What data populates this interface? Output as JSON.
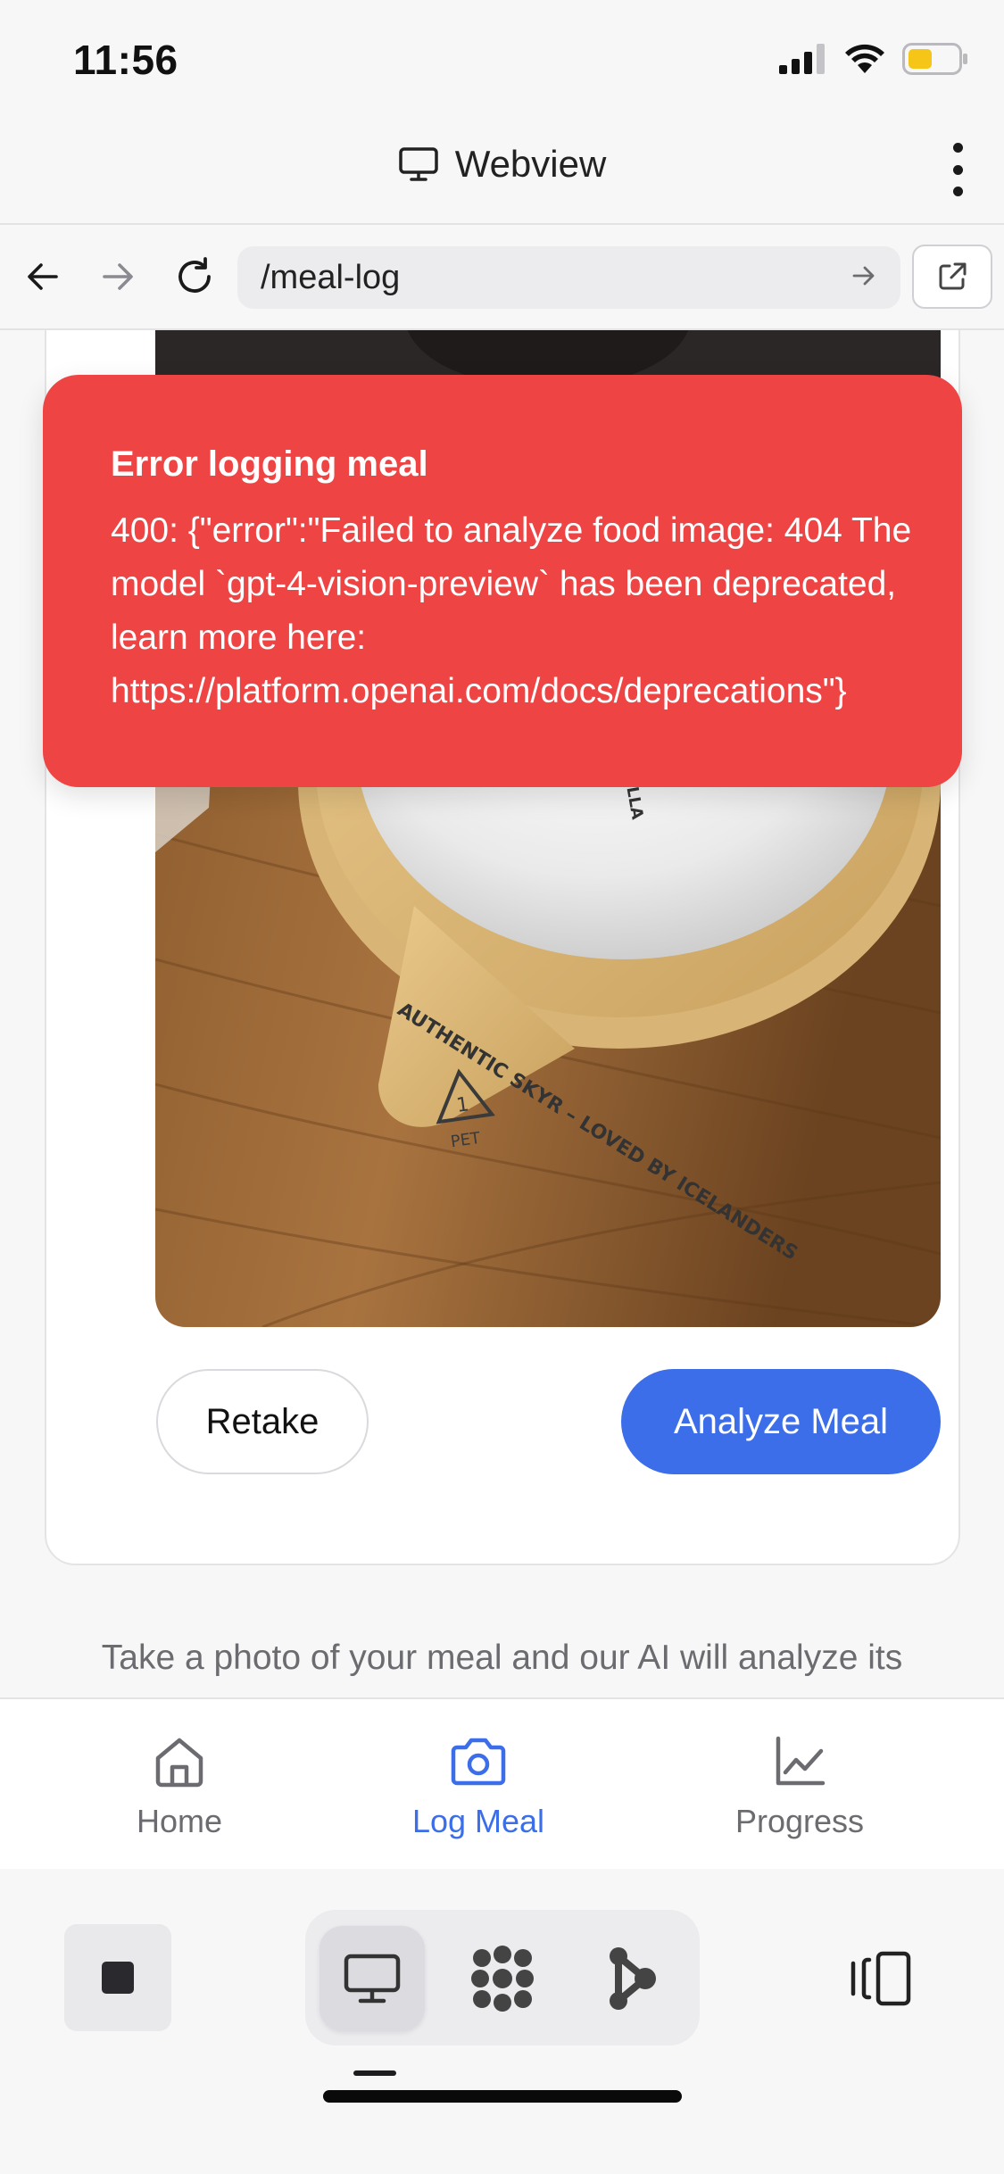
{
  "status": {
    "time": "11:56",
    "battery_color": "#f5c518"
  },
  "webview": {
    "title": "Webview",
    "icon": "monitor-icon"
  },
  "browser": {
    "url": "/meal-log"
  },
  "error_toast": {
    "title": "Error logging meal",
    "message": "400: {\"error\":\"Failed to analyze food image: 404 The model `gpt-4-vision-preview` has been deprecated, learn more here: https://platform.openai.com/docs/deprecations\"}"
  },
  "actions": {
    "retake_label": "Retake",
    "analyze_label": "Analyze Meal"
  },
  "hint_text": "Take a photo of your meal and our AI will analyze its",
  "photo": {
    "lid_text": "AUTHENTIC SKYR – LOVED BY ICELANDERS",
    "flavor": "VANILLA",
    "recycle_code": "1",
    "recycle_label": "PET"
  },
  "tabs": [
    {
      "label": "Home",
      "icon": "home-icon",
      "active": false
    },
    {
      "label": "Log Meal",
      "icon": "camera-icon",
      "active": true
    },
    {
      "label": "Progress",
      "icon": "chart-icon",
      "active": false
    }
  ],
  "colors": {
    "accent": "#3b6ee8",
    "error": "#ef4444"
  }
}
